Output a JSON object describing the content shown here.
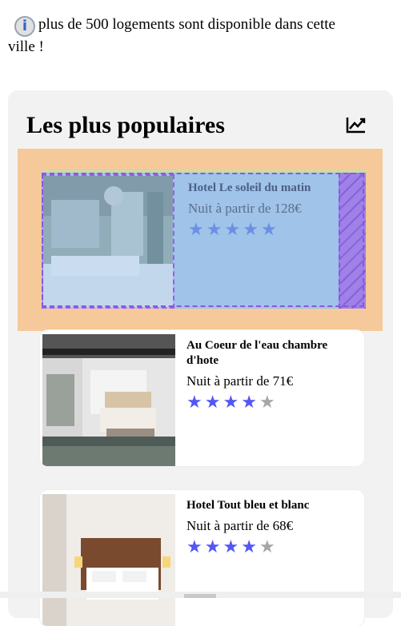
{
  "info": {
    "icon": "info-icon",
    "icon_glyph": "i",
    "text": "plus de 500 logements sont disponible dans cette ville !"
  },
  "section": {
    "title": "Les plus populaires",
    "trend_icon": "trending-up-icon"
  },
  "hotels": [
    {
      "name": "Hotel Le soleil du matin",
      "price": "Nuit à partir de 128€",
      "rating": 5,
      "max_rating": 5,
      "selected": true
    },
    {
      "name": "Au Coeur de l'eau chambre d'hote",
      "price": "Nuit à partir de 71€",
      "rating": 4,
      "max_rating": 5,
      "selected": false
    },
    {
      "name": "Hotel Tout bleu et blanc",
      "price": "Nuit à partir de 68€",
      "rating": 4,
      "max_rating": 5,
      "selected": false
    }
  ],
  "colors": {
    "panel_bg": "#f2f2f2",
    "highlight": "#f5c99a",
    "star_on": "#5257f5",
    "star_off": "#a6a6a6",
    "selection": "#8a55e6"
  }
}
